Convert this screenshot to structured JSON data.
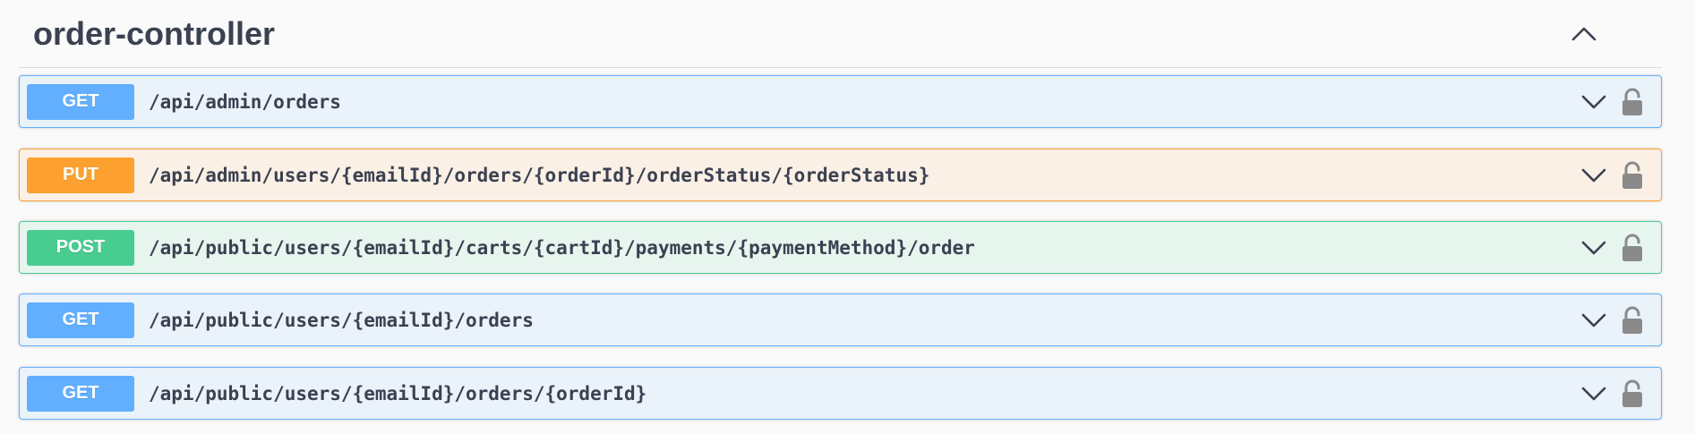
{
  "tag": {
    "title": "order-controller",
    "toggle_icon": "chevron-up-icon"
  },
  "operations": [
    {
      "method": "GET",
      "path": "/api/admin/orders",
      "color": "#61affe",
      "chevron_icon": "chevron-down-icon",
      "lock_icon": "unlocked-icon"
    },
    {
      "method": "PUT",
      "path": "/api/admin/users/{emailId}/orders/{orderId}/orderStatus/{orderStatus}",
      "color": "#fca130",
      "chevron_icon": "chevron-down-icon",
      "lock_icon": "unlocked-icon"
    },
    {
      "method": "POST",
      "path": "/api/public/users/{emailId}/carts/{cartId}/payments/{paymentMethod}/order",
      "color": "#49cc90",
      "chevron_icon": "chevron-down-icon",
      "lock_icon": "unlocked-icon"
    },
    {
      "method": "GET",
      "path": "/api/public/users/{emailId}/orders",
      "color": "#61affe",
      "chevron_icon": "chevron-down-icon",
      "lock_icon": "unlocked-icon"
    },
    {
      "method": "GET",
      "path": "/api/public/users/{emailId}/orders/{orderId}",
      "color": "#61affe",
      "chevron_icon": "chevron-down-icon",
      "lock_icon": "unlocked-icon"
    }
  ]
}
